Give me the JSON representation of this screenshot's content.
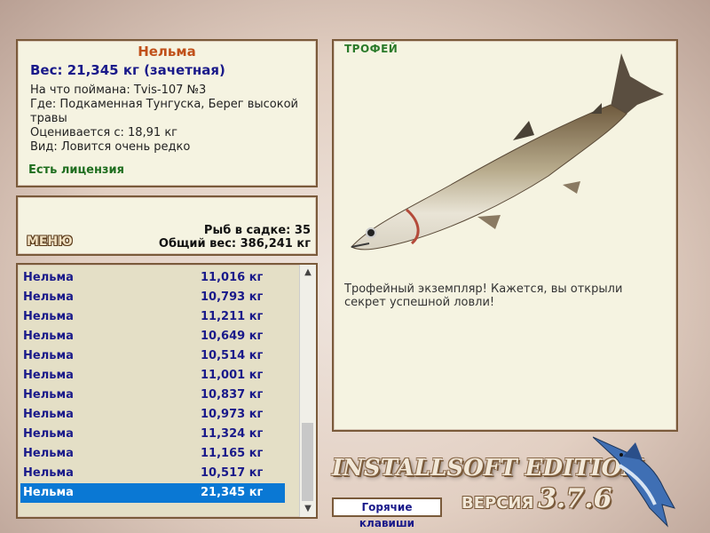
{
  "info": {
    "fish_name": "Нельма",
    "weight_line": "Вес: 21,345 кг (зачетная)",
    "bait": "На что поймана: Tvis-107 №3",
    "location": "Где: Подкаменная Тунгуска, Берег высокой травы",
    "valued_from": "Оценивается с: 18,91 кг",
    "kind": "Вид: Ловится очень редко",
    "license": "Есть лицензия"
  },
  "menu": {
    "label": "МЕНЮ",
    "fish_in_keepnet": "Рыб в садке: 35",
    "total_weight": "Общий вес: 386,241 кг"
  },
  "catch_list": [
    {
      "name": "Нельма",
      "weight": "11,016 кг"
    },
    {
      "name": "Нельма",
      "weight": "10,793 кг"
    },
    {
      "name": "Нельма",
      "weight": "11,211 кг"
    },
    {
      "name": "Нельма",
      "weight": "10,649 кг"
    },
    {
      "name": "Нельма",
      "weight": "10,514 кг"
    },
    {
      "name": "Нельма",
      "weight": "11,001 кг"
    },
    {
      "name": "Нельма",
      "weight": "10,837 кг"
    },
    {
      "name": "Нельма",
      "weight": "10,973 кг"
    },
    {
      "name": "Нельма",
      "weight": "11,324 кг"
    },
    {
      "name": "Нельма",
      "weight": "11,165 кг"
    },
    {
      "name": "Нельма",
      "weight": "10,517 кг"
    },
    {
      "name": "Нельма",
      "weight": "21,345 кг",
      "selected": true
    }
  ],
  "trophy": {
    "tag": "ТРОФЕЙ",
    "description": "Трофейный экземпляр! Кажется, вы открыли секрет успешной ловли!"
  },
  "footer": {
    "brand": "INSTALLSOFT EDITION",
    "version_label": "ВЕРСИЯ",
    "version_number": "3.7.6",
    "hotkeys": "Горячие клавиши"
  },
  "colors": {
    "accent_title": "#c0501a",
    "weight_text": "#1a1a8a",
    "license_text": "#1f6e1f",
    "selection": "#0a78d4",
    "panel_bg": "#f5f3e1",
    "panel_border": "#7a5a3a"
  },
  "icons": {
    "scroll_up": "chevron-up-icon",
    "scroll_down": "chevron-down-icon"
  }
}
